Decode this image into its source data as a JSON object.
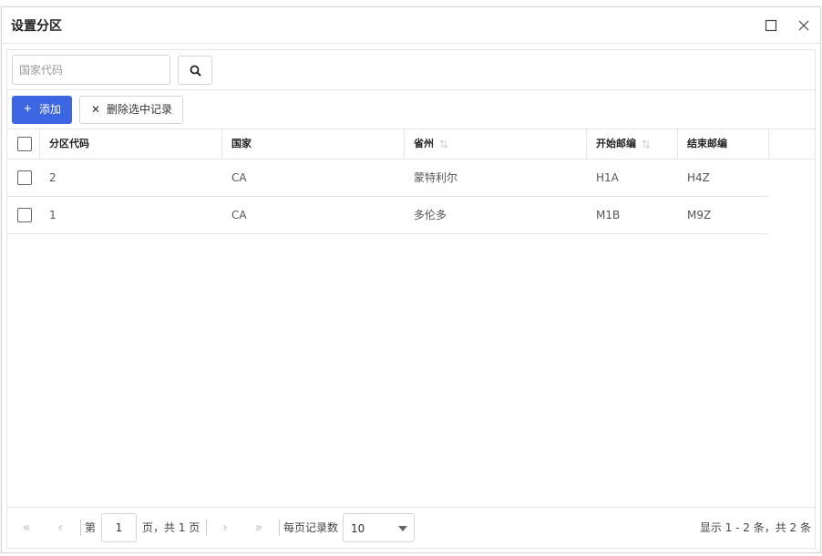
{
  "dialog": {
    "title": "设置分区",
    "maximize_icon": "maximize-icon",
    "close_icon": "close-icon"
  },
  "search": {
    "placeholder": "国家代码",
    "value": "",
    "button_icon": "search-icon"
  },
  "toolbar": {
    "add_label": "添加",
    "delete_label": "删除选中记录"
  },
  "table": {
    "columns": [
      {
        "label": "分区代码",
        "sortable": false
      },
      {
        "label": "国家",
        "sortable": false
      },
      {
        "label": "省州",
        "sortable": true
      },
      {
        "label": "开始邮编",
        "sortable": true
      },
      {
        "label": "结束邮编",
        "sortable": false
      }
    ],
    "rows": [
      {
        "code": "2",
        "country": "CA",
        "province": "蒙特利尔",
        "start_zip": "H1A",
        "end_zip": "H4Z"
      },
      {
        "code": "1",
        "country": "CA",
        "province": "多伦多",
        "start_zip": "M1B",
        "end_zip": "M9Z"
      }
    ]
  },
  "pager": {
    "page_prefix": "第",
    "current_page": "1",
    "page_suffix": "页，共 1 页",
    "per_page_label": "每页记录数",
    "per_page_value": "10",
    "info": "显示 1 - 2 条，共 2 条"
  },
  "colors": {
    "primary": "#3d66e3",
    "border": "#e5e5e5",
    "disabled_icon": "#bbbbbb"
  }
}
